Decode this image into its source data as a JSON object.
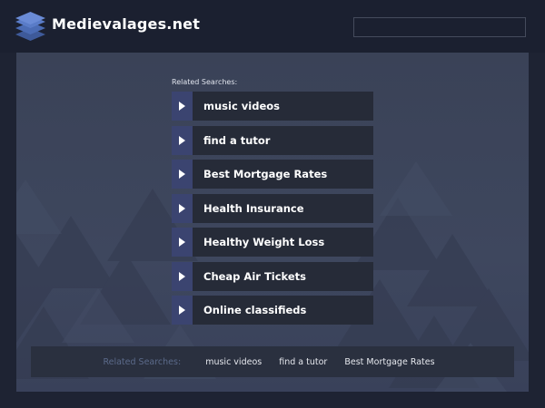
{
  "header": {
    "site_title": "Medievalages.net",
    "logo_icon": "stacked-layers-icon",
    "search_placeholder": ""
  },
  "main": {
    "related_label": "Related Searches:",
    "links": [
      {
        "label": "music videos"
      },
      {
        "label": "find a tutor"
      },
      {
        "label": "Best Mortgage Rates"
      },
      {
        "label": "Health Insurance"
      },
      {
        "label": "Healthy Weight Loss"
      },
      {
        "label": "Cheap Air Tickets"
      },
      {
        "label": "Online classifieds"
      }
    ]
  },
  "footer": {
    "label": "Related Searches:",
    "links": [
      "music videos",
      "find a tutor",
      "Best Mortgage Rates"
    ]
  },
  "colors": {
    "background": "#1e2333",
    "panel": "#3b4359",
    "link_row": "#262b38",
    "arrow_block": "#3b4470",
    "footer_bar": "#2a303f"
  }
}
